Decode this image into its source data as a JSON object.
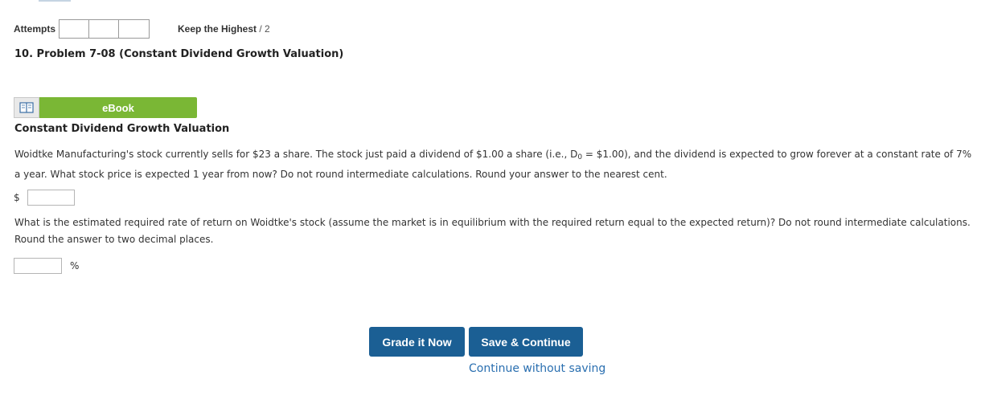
{
  "attempts": {
    "label": "Attempts",
    "keep_label": "Keep the Highest",
    "keep_separator": " / ",
    "keep_max": "2"
  },
  "problem": {
    "title": "10.  Problem 7-08 (Constant Dividend Growth Valuation)"
  },
  "ebook": {
    "label": "eBook",
    "icon": "book-icon"
  },
  "section": {
    "title": "Constant Dividend Growth Valuation"
  },
  "question1": {
    "part1": "Woidtke Manufacturing's stock currently sells for $23 a share. The stock just paid a dividend of $1.00 a share (i.e., D",
    "subscript": "0",
    "part2": " = $1.00), and the dividend is expected to grow forever at a constant rate of 7% a year. What stock price is expected 1 year from now? Do not round intermediate calculations. Round your answer to the nearest cent.",
    "currency": "$",
    "value": ""
  },
  "question2": {
    "text": "What is the estimated required rate of return on Woidtke's stock (assume the market is in equilibrium with the required return equal to the expected return)? Do not round intermediate calculations. Round the answer to two decimal places.",
    "unit": "%",
    "value": ""
  },
  "actions": {
    "grade": "Grade it Now",
    "save": "Save & Continue",
    "continue": "Continue without saving"
  },
  "colors": {
    "accent_blue": "#1b5f94",
    "ebook_green": "#7ab735",
    "link_blue": "#2a6fb0"
  }
}
